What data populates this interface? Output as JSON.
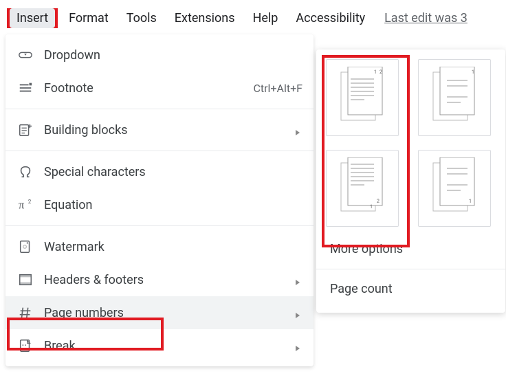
{
  "menubar": {
    "insert": "Insert",
    "format": "Format",
    "tools": "Tools",
    "extensions": "Extensions",
    "help": "Help",
    "accessibility": "Accessibility",
    "last_edit": "Last edit was 3"
  },
  "menu": {
    "dropdown": {
      "label": "Dropdown"
    },
    "footnote": {
      "label": "Footnote",
      "shortcut": "Ctrl+Alt+F"
    },
    "building_blocks": {
      "label": "Building blocks"
    },
    "special_chars": {
      "label": "Special characters"
    },
    "equation": {
      "label": "Equation"
    },
    "watermark": {
      "label": "Watermark"
    },
    "headers_footers": {
      "label": "Headers & footers"
    },
    "page_numbers": {
      "label": "Page numbers"
    },
    "break": {
      "label": "Break"
    }
  },
  "submenu": {
    "more_options": "More options",
    "page_count": "Page count"
  }
}
